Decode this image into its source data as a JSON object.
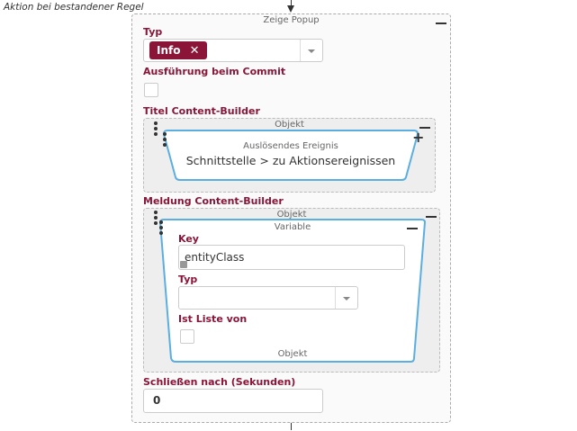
{
  "heading": "Aktion bei bestandener Regel",
  "node": {
    "title": "Zeige Popup",
    "typ_label": "Typ",
    "typ_value": "Info",
    "commit_label": "Ausführung beim Commit",
    "titel_label": "Titel Content-Builder",
    "titel_object": {
      "title": "Objekt",
      "card_caption": "Auslösendes Ereignis",
      "card_value": "Schnittstelle > zu Aktionsereignissen"
    },
    "meldung_label": "Meldung Content-Builder",
    "meldung_object": {
      "title": "Objekt",
      "variable_title": "Variable",
      "key_label": "Key",
      "key_value": "entityClass",
      "typ_label": "Typ",
      "typ_value": "",
      "liste_label": "Ist Liste von",
      "footer": "Objekt"
    },
    "schliessen_label": "Schließen nach (Sekunden)",
    "schliessen_value": "0"
  },
  "icons": {
    "remove_tag": "close-icon",
    "collapse": "minus-icon",
    "add": "plus-icon",
    "drag": "drag-handle-icon",
    "dropdown": "chevron-down-icon",
    "resize": "resize-icon"
  },
  "colors": {
    "accent": "#8a1538",
    "highlight_border": "#5aaee0"
  }
}
